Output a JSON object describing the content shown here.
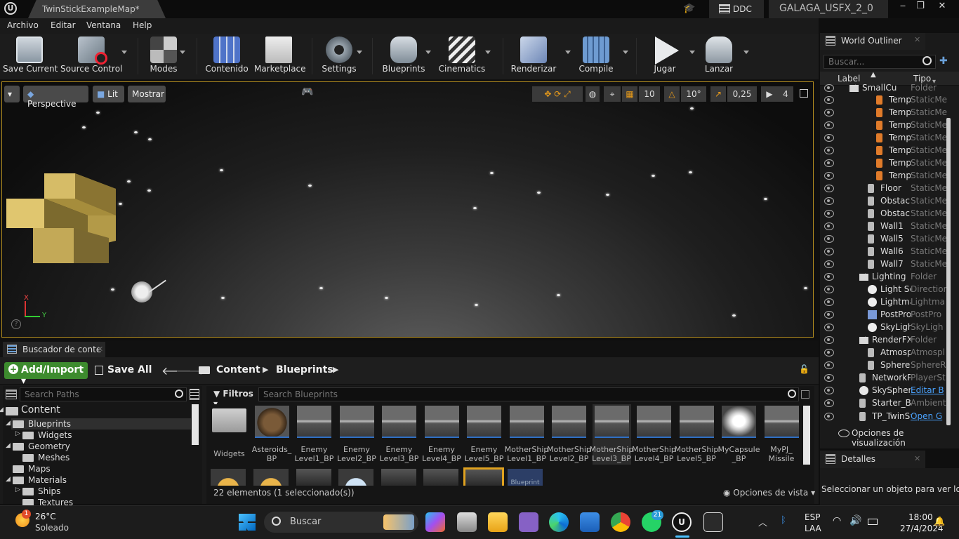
{
  "titlebar": {
    "tab_title": "TwinStickExampleMap*",
    "ddc_label": "DDC",
    "project_name": "GALAGA_USFX_2_0",
    "minimize": "‒",
    "maximize": "❐",
    "close": "✕"
  },
  "menu": [
    "Archivo",
    "Editar",
    "Ventana",
    "Help"
  ],
  "toolbar": [
    {
      "label": "Save Current",
      "icon": "save-icon"
    },
    {
      "label": "Source Control",
      "icon": "source-control-icon"
    },
    {
      "label": "Modes",
      "icon": "modes-icon"
    },
    {
      "label": "Contenido",
      "icon": "content-icon"
    },
    {
      "label": "Marketplace",
      "icon": "marketplace-icon"
    },
    {
      "label": "Settings",
      "icon": "settings-icon"
    },
    {
      "label": "Blueprints",
      "icon": "blueprints-icon"
    },
    {
      "label": "Cinematics",
      "icon": "cinematics-icon"
    },
    {
      "label": "Renderizar",
      "icon": "build-icon"
    },
    {
      "label": "Compile",
      "icon": "compile-icon"
    },
    {
      "label": "Jugar",
      "icon": "play-icon"
    },
    {
      "label": "Lanzar",
      "icon": "launch-icon"
    }
  ],
  "viewport": {
    "perspective": "Perspective",
    "lit": "Lit",
    "show": "Mostrar",
    "grid_snap": "10",
    "rotation_snap": "10°",
    "scale_snap": "0,25",
    "camera_speed": "4",
    "axis_x": "X",
    "axis_y": "Y",
    "help": "?"
  },
  "outliner": {
    "tab": "World Outliner",
    "search_placeholder": "Buscar...",
    "col_label": "Label",
    "col_type": "Tipo",
    "rows": [
      {
        "name": "SmallCu",
        "type": "Folder"
      },
      {
        "name": "Templ",
        "type": "StaticMe"
      },
      {
        "name": "Templ",
        "type": "StaticMe"
      },
      {
        "name": "Templ",
        "type": "StaticMe"
      },
      {
        "name": "Templ",
        "type": "StaticMe"
      },
      {
        "name": "Templ",
        "type": "StaticMe"
      },
      {
        "name": "Templ",
        "type": "StaticMe"
      },
      {
        "name": "Templ",
        "type": "StaticMe"
      },
      {
        "name": "Floor",
        "type": "StaticMe"
      },
      {
        "name": "Obstacle",
        "type": "StaticMe"
      },
      {
        "name": "Obstacle",
        "type": "StaticMe"
      },
      {
        "name": "Wall1",
        "type": "StaticMe"
      },
      {
        "name": "Wall5",
        "type": "StaticMe"
      },
      {
        "name": "Wall6",
        "type": "StaticMe"
      },
      {
        "name": "Wall7",
        "type": "StaticMe"
      },
      {
        "name": "Lighting",
        "type": "Folder"
      },
      {
        "name": "Light So",
        "type": "Direction"
      },
      {
        "name": "Lightma",
        "type": "Lightma"
      },
      {
        "name": "PostPro",
        "type": "PostPro"
      },
      {
        "name": "SkyLigh",
        "type": "SkyLigh"
      },
      {
        "name": "RenderFX",
        "type": "Folder"
      },
      {
        "name": "Atmospl",
        "type": "Atmospl"
      },
      {
        "name": "SphereR",
        "type": "SphereR"
      },
      {
        "name": "NetworkPl",
        "type": "PlayerSt"
      },
      {
        "name": "SkySphere",
        "type": "Editar B"
      },
      {
        "name": "Starter_Ba",
        "type": "Ambient"
      },
      {
        "name": "TP_TwinSt",
        "type": "Open G"
      }
    ],
    "view_options": "Opciones de visualización"
  },
  "details": {
    "tab": "Detalles",
    "hint": "Seleccionar un objeto para ver los d"
  },
  "content_browser": {
    "tab": "Buscador de conte",
    "add_import": "Add/Import",
    "save_all": "Save All",
    "breadcrumb": [
      "Content",
      "Blueprints"
    ],
    "path_search_placeholder": "Search Paths",
    "filters": "Filtros",
    "asset_search_placeholder": "Search Blueprints",
    "tree": [
      {
        "label": "Content",
        "depth": 0
      },
      {
        "label": "Blueprints",
        "depth": 1
      },
      {
        "label": "Widgets",
        "depth": 2
      },
      {
        "label": "Geometry",
        "depth": 1
      },
      {
        "label": "Meshes",
        "depth": 2
      },
      {
        "label": "Maps",
        "depth": 1
      },
      {
        "label": "Materials",
        "depth": 1
      },
      {
        "label": "Ships",
        "depth": 2
      },
      {
        "label": "Textures",
        "depth": 2
      }
    ],
    "assets": [
      {
        "name": "Widgets",
        "kind": "folder"
      },
      {
        "name": "Asteroids_\nBP",
        "kind": "rock"
      },
      {
        "name": "Enemy\nLevel1_BP",
        "kind": "ship"
      },
      {
        "name": "Enemy\nLevel2_BP",
        "kind": "ship"
      },
      {
        "name": "Enemy\nLevel3_BP",
        "kind": "ship"
      },
      {
        "name": "Enemy\nLevel4_BP",
        "kind": "ship"
      },
      {
        "name": "Enemy\nLevel5_BP",
        "kind": "ship"
      },
      {
        "name": "MotherShip\nLevel1_BP",
        "kind": "ship"
      },
      {
        "name": "MotherShip\nLevel2_BP",
        "kind": "ship"
      },
      {
        "name": "MotherShip\nLevel3_BP",
        "kind": "ship"
      },
      {
        "name": "MotherShip\nLevel4_BP",
        "kind": "ship"
      },
      {
        "name": "MotherShip\nLevel5_BP",
        "kind": "ship"
      },
      {
        "name": "MyCapsule\n_BP",
        "kind": "capsule"
      },
      {
        "name": "MyPJ_\nMissile",
        "kind": "ship"
      }
    ],
    "second_row_label": "Blueprint",
    "status": "22 elementos (1 seleccionado(s))",
    "view_options": "Opciones de vista"
  },
  "taskbar": {
    "weather_temp": "26°C",
    "weather_desc": "Soleado",
    "weather_badge": "1",
    "search": "Buscar",
    "whatsapp_badge": "21",
    "lang1": "ESP",
    "lang2": "LAA",
    "time": "18:00",
    "date": "27/4/2024"
  }
}
